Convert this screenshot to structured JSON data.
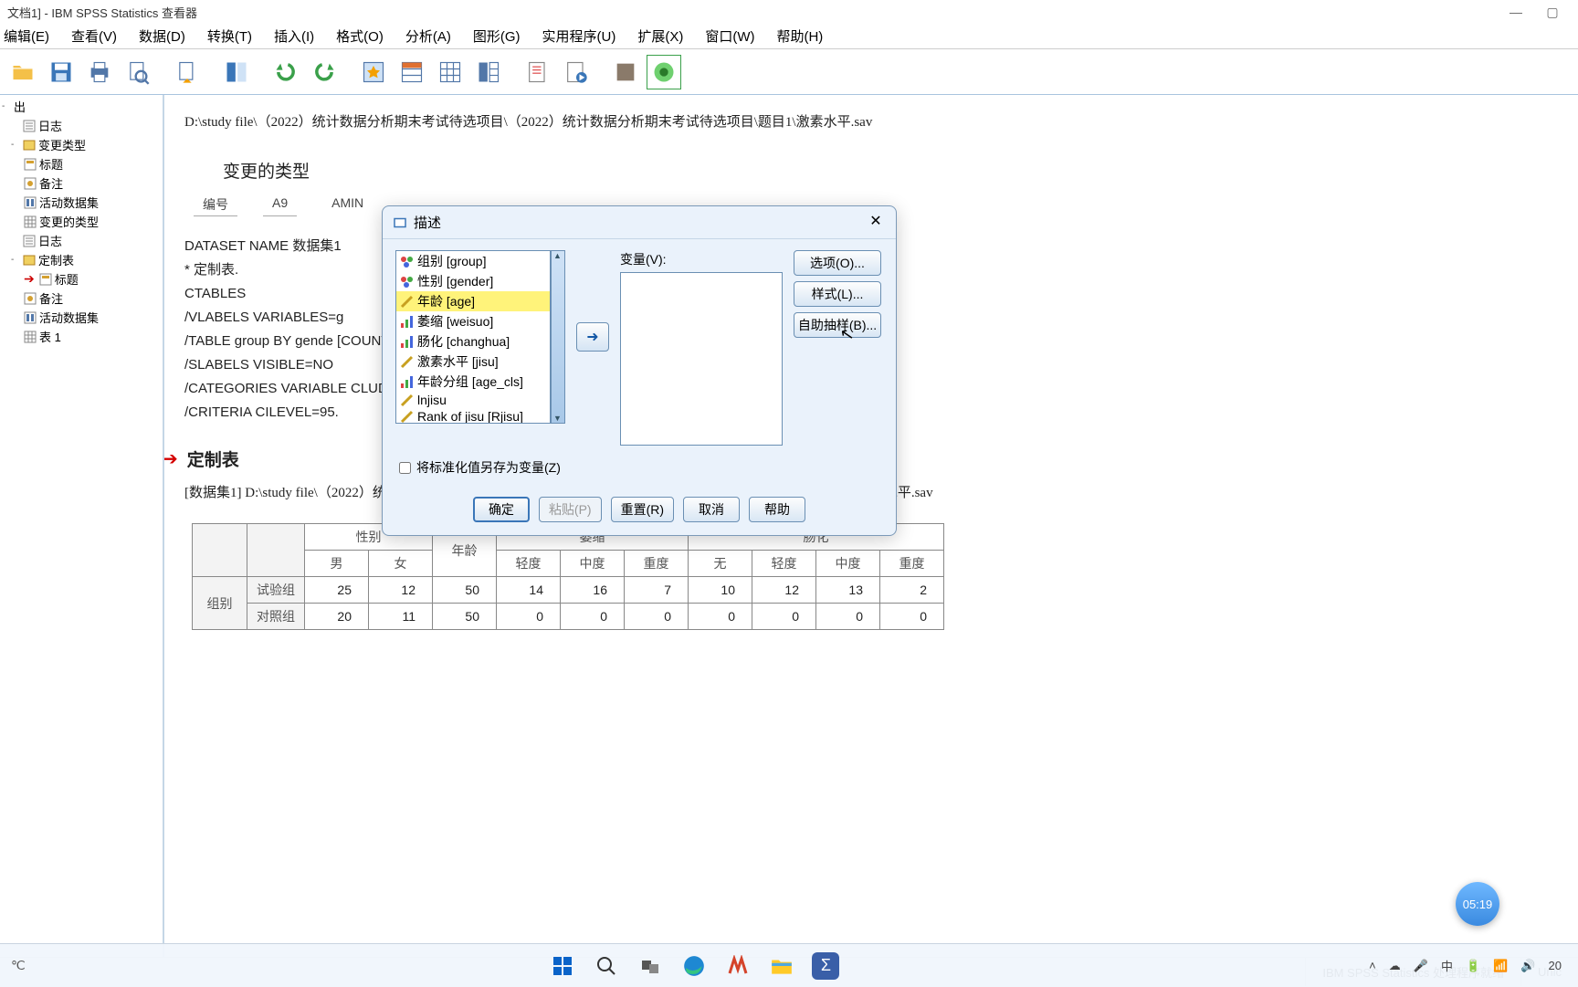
{
  "title": "文档1] - IBM SPSS Statistics 查看器",
  "menu": [
    "编辑(E)",
    "查看(V)",
    "数据(D)",
    "转换(T)",
    "插入(I)",
    "格式(O)",
    "分析(A)",
    "图形(G)",
    "实用程序(U)",
    "扩展(X)",
    "窗口(W)",
    "帮助(H)"
  ],
  "nav": {
    "root": "出",
    "items": [
      {
        "icon": "log",
        "label": "日志",
        "indent": 1,
        "toggle": ""
      },
      {
        "icon": "folder",
        "label": "变更类型",
        "indent": 1,
        "toggle": "-"
      },
      {
        "icon": "title",
        "label": "标题",
        "indent": 2
      },
      {
        "icon": "note",
        "label": "备注",
        "indent": 2
      },
      {
        "icon": "data",
        "label": "活动数据集",
        "indent": 2
      },
      {
        "icon": "table",
        "label": "变更的类型",
        "indent": 2
      },
      {
        "icon": "log",
        "label": "日志",
        "indent": 1,
        "toggle": ""
      },
      {
        "icon": "folder",
        "label": "定制表",
        "indent": 1,
        "toggle": "-"
      },
      {
        "icon": "title",
        "label": "标题",
        "indent": 2,
        "arrow": true
      },
      {
        "icon": "note",
        "label": "备注",
        "indent": 2
      },
      {
        "icon": "data",
        "label": "活动数据集",
        "indent": 2
      },
      {
        "icon": "table",
        "label": "表 1",
        "indent": 2
      }
    ]
  },
  "content": {
    "path": "D:\\study file\\（2022）统计数据分析期末考试待选项目\\（2022）统计数据分析期末考试待选项目\\题目1\\激素水平.sav",
    "section1_title": "变更的类型",
    "field_labels": [
      "编号",
      "A9",
      "AMIN"
    ],
    "syntax": [
      "DATASET NAME 数据集1",
      "* 定制表.",
      "CTABLES",
      "  /VLABELS VARIABLES=g",
      "  /TABLE group BY gende                                                                                                [COUNT F40.0]",
      "  /SLABELS VISIBLE=NO",
      "  /CATEGORIES VARIABLE                                                                                               CLUDE",
      "  /CRITERIA CILEVEL=95."
    ],
    "section2_title": "定制表",
    "dataset_line": "[数据集1] D:\\study file\\（2022）统计数据分析期末考试待选项目\\（2022）统计数据分析期末考试待选项目\\题目1\\激素水平.sav",
    "table": {
      "top_headers": [
        "",
        "",
        "性别",
        "",
        "",
        "萎缩",
        "",
        "",
        "",
        "肠化",
        "",
        ""
      ],
      "sub_headers": [
        "",
        "",
        "男",
        "女",
        "年龄",
        "轻度",
        "中度",
        "重度",
        "无",
        "轻度",
        "中度",
        "重度"
      ],
      "row_header": "组别",
      "rows": [
        {
          "label": "试验组",
          "cells": [
            25,
            12,
            50,
            14,
            16,
            7,
            10,
            12,
            13,
            2
          ]
        },
        {
          "label": "对照组",
          "cells": [
            20,
            11,
            50,
            0,
            0,
            0,
            0,
            0,
            0,
            0
          ]
        }
      ]
    }
  },
  "dialog": {
    "title": "描述",
    "target_label": "变量(V):",
    "variables": [
      {
        "icon": "nominal",
        "label": "组别 [group]"
      },
      {
        "icon": "nominal",
        "label": "性别 [gender]"
      },
      {
        "icon": "scale",
        "label": "年龄 [age]",
        "selected": true
      },
      {
        "icon": "ordinal",
        "label": "萎缩 [weisuo]"
      },
      {
        "icon": "ordinal",
        "label": "肠化 [changhua]"
      },
      {
        "icon": "scale",
        "label": "激素水平 [jisu]"
      },
      {
        "icon": "ordinal",
        "label": "年龄分组 [age_cls]"
      },
      {
        "icon": "scale",
        "label": "lnjisu"
      },
      {
        "icon": "scale",
        "label": "Rank of jisu [Rjisu]"
      }
    ],
    "side_buttons": [
      "选项(O)...",
      "样式(L)...",
      "自助抽样(B)..."
    ],
    "checkbox": "将标准化值另存为变量(Z)",
    "footer": [
      "确定",
      "粘贴(P)",
      "重置(R)",
      "取消",
      "帮助"
    ]
  },
  "status": {
    "proc": "IBM SPSS Statistics 处理程序就绪",
    "enc": "Unic"
  },
  "timer": "05:19",
  "taskbar": {
    "temp": "℃",
    "time": "20"
  },
  "chart_data": {
    "type": "table",
    "title": "定制表",
    "row_group_label": "组别",
    "column_groups": [
      {
        "name": "性别",
        "cols": [
          "男",
          "女"
        ]
      },
      {
        "name": "年龄",
        "cols": [
          "年龄"
        ]
      },
      {
        "name": "萎缩",
        "cols": [
          "轻度",
          "中度",
          "重度"
        ]
      },
      {
        "name": "肠化",
        "cols": [
          "无",
          "轻度",
          "中度",
          "重度"
        ]
      }
    ],
    "rows": [
      {
        "label": "试验组",
        "values": [
          25,
          12,
          50,
          14,
          16,
          7,
          10,
          12,
          13,
          2
        ]
      },
      {
        "label": "对照组",
        "values": [
          20,
          11,
          50,
          0,
          0,
          0,
          0,
          0,
          0,
          0
        ]
      }
    ]
  }
}
